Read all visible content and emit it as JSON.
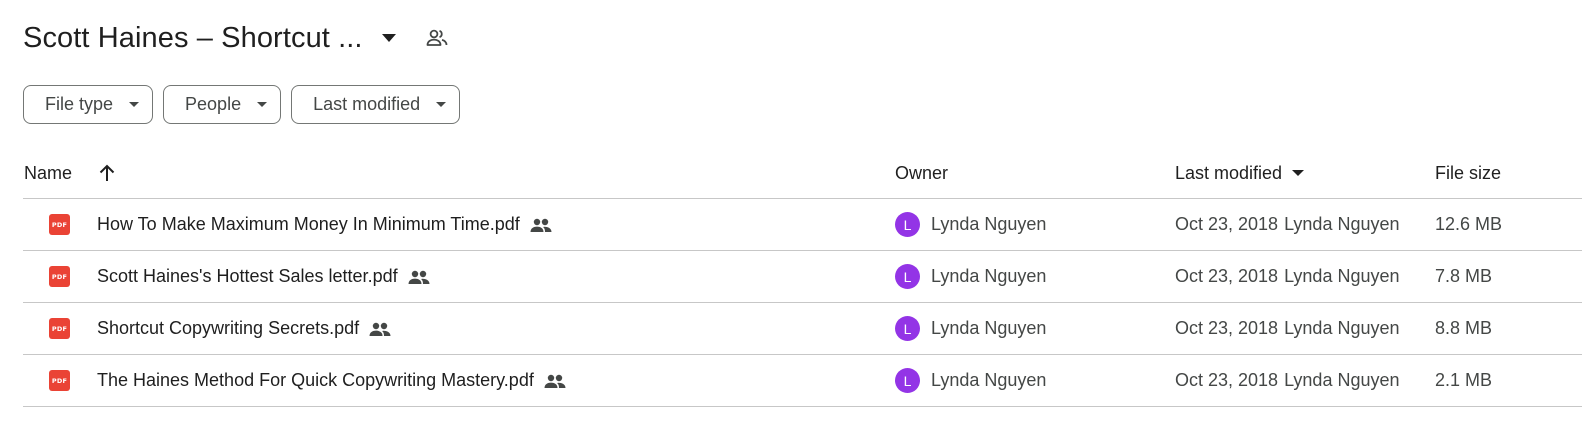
{
  "header": {
    "title": "Scott Haines – Shortcut ...",
    "caret_icon": "arrow-drop-down-icon",
    "shared_icon": "people-icon"
  },
  "filters": [
    {
      "label": "File type"
    },
    {
      "label": "People"
    },
    {
      "label": "Last modified"
    }
  ],
  "table": {
    "columns": {
      "name": "Name",
      "owner": "Owner",
      "last_modified": "Last modified",
      "file_size": "File size"
    },
    "sort": {
      "column": "Name",
      "direction": "ascending",
      "icon": "arrow-upward-icon"
    },
    "rows": [
      {
        "name": "How To Make Maximum Money In Minimum Time.pdf",
        "owner_initial": "L",
        "owner": "Lynda Nguyen",
        "modified_date": "Oct 23, 2018",
        "modified_by": "Lynda Nguyen",
        "size": "12.6 MB"
      },
      {
        "name": "Scott Haines's Hottest Sales letter.pdf",
        "owner_initial": "L",
        "owner": "Lynda Nguyen",
        "modified_date": "Oct 23, 2018",
        "modified_by": "Lynda Nguyen",
        "size": "7.8 MB"
      },
      {
        "name": "Shortcut Copywriting Secrets.pdf",
        "owner_initial": "L",
        "owner": "Lynda Nguyen",
        "modified_date": "Oct 23, 2018",
        "modified_by": "Lynda Nguyen",
        "size": "8.8 MB"
      },
      {
        "name": "The Haines Method For Quick Copywriting Mastery.pdf",
        "owner_initial": "L",
        "owner": "Lynda Nguyen",
        "modified_date": "Oct 23, 2018",
        "modified_by": "Lynda Nguyen",
        "size": "2.1 MB"
      }
    ]
  },
  "file_icon_label": "PDF",
  "colors": {
    "pdf_red": "#ea4335",
    "avatar_purple": "#9334e6",
    "divider": "#c7c7c7",
    "chip_border": "#747775"
  }
}
